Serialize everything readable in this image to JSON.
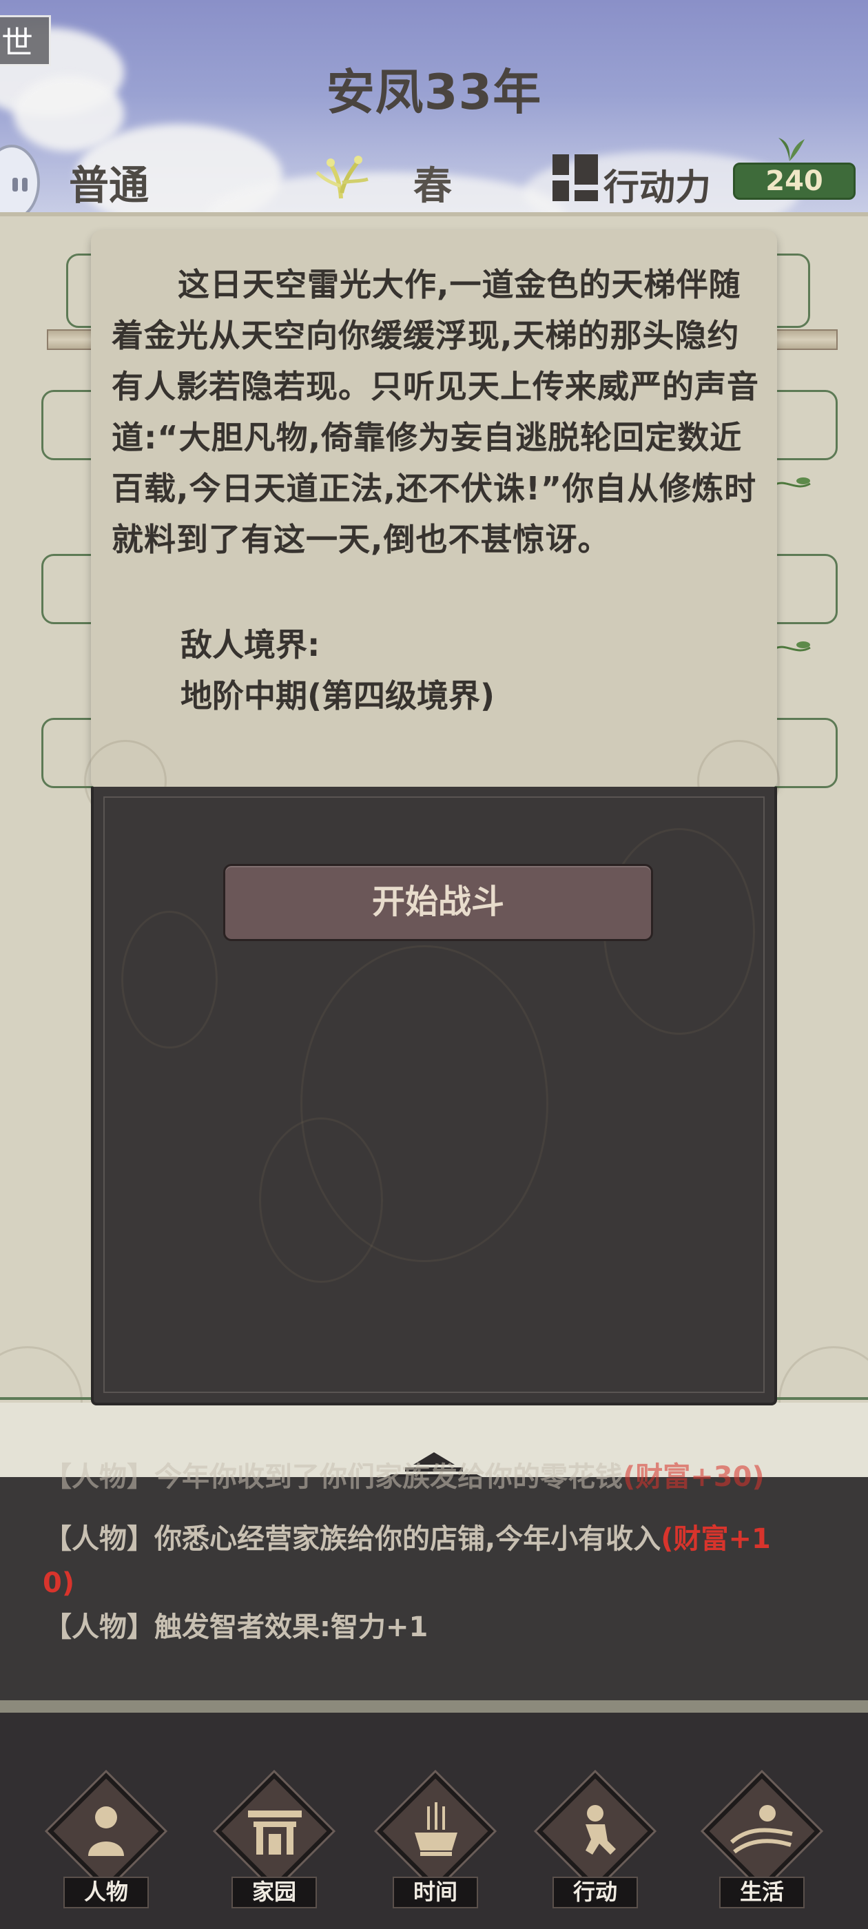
{
  "header": {
    "menu_tab_char": "世",
    "year_title": "安凤33年",
    "difficulty": "普通",
    "season": "春",
    "action_points_label": "行动力",
    "action_points_value": "240"
  },
  "modal": {
    "story_text": "这日天空雷光大作,一道金色的天梯伴随着金光从天空向你缓缓浮现,天梯的那头隐约有人影若隐若现。只听见天上传来威严的声音道:“大胆凡物,倚靠修为妄自逃脱轮回定数近百载,今日天道正法,还不伏诛!”你自从修炼时就料到了有这一天,倒也不甚惊讶。",
    "enemy_label": "敌人境界:",
    "enemy_realm": "地阶中期(第四级境界)",
    "fight_button": "开始战斗"
  },
  "log": {
    "faded_prefix": "【人物】",
    "faded_text": "今年你收到了你们家族发给你的零花钱",
    "faded_reward": "(财富+30)",
    "lines": [
      {
        "prefix": "【人物】",
        "text": "你悉心经营家族给你的店铺,今年小有收入",
        "reward": "(财富+1",
        "reward2": "0)"
      },
      {
        "prefix": "【人物】",
        "text": "触发智者效果:智力+1"
      }
    ]
  },
  "nav": {
    "items": [
      {
        "label": "人物",
        "icon": "person-icon"
      },
      {
        "label": "家园",
        "icon": "gate-icon"
      },
      {
        "label": "时间",
        "icon": "incense-icon"
      },
      {
        "label": "行动",
        "icon": "action-icon"
      },
      {
        "label": "生活",
        "icon": "landscape-icon"
      }
    ]
  },
  "colors": {
    "accent_green": "#3e6b3a",
    "reward_red": "#d8342c",
    "dark_panel": "#3b3838"
  }
}
